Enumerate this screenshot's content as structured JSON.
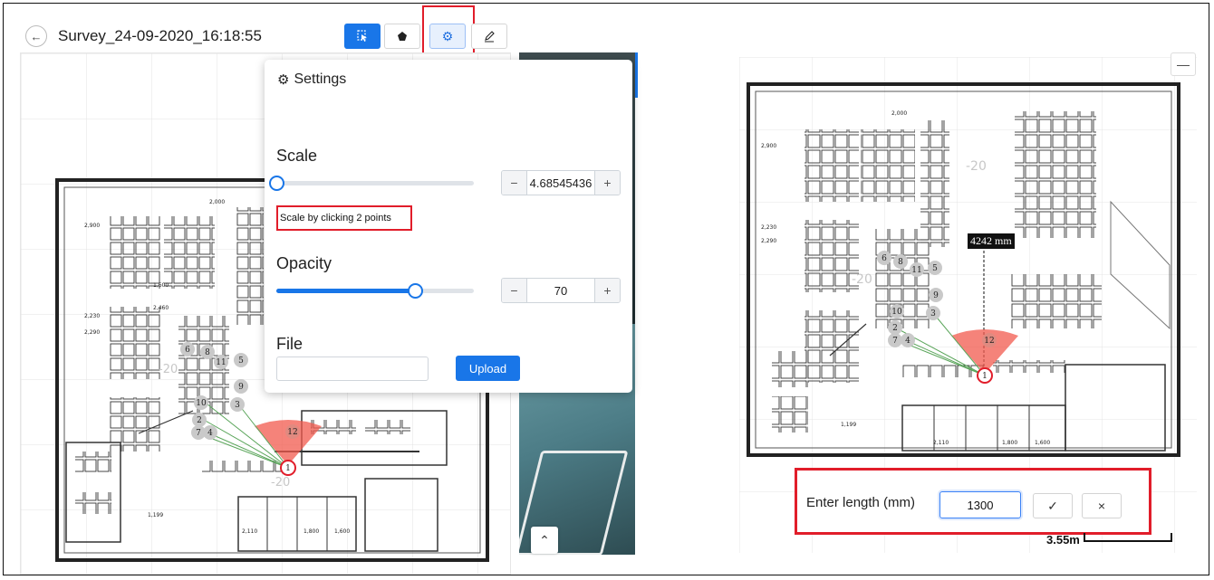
{
  "header": {
    "back_icon": "arrow-left-icon",
    "title": "Survey_24-09-2020_16:18:55",
    "tools": [
      {
        "name": "select-tool",
        "icon": "cursor-icon",
        "state": "active"
      },
      {
        "name": "shape-tool",
        "icon": "polygon-icon",
        "state": "normal"
      },
      {
        "name": "settings-tool",
        "icon": "gear-icon",
        "state": "selected",
        "highlighted": true
      },
      {
        "name": "draw-tool",
        "icon": "pen-icon",
        "state": "normal"
      }
    ]
  },
  "settings": {
    "title": "Settings",
    "scale": {
      "label": "Scale",
      "value": "4.68545436",
      "slider_fraction": 0.0,
      "hint": "Scale by clicking 2 points",
      "minus": "−",
      "plus": "+"
    },
    "opacity": {
      "label": "Opacity",
      "value": "70",
      "slider_fraction": 0.7,
      "minus": "−",
      "plus": "+"
    },
    "file": {
      "label": "File",
      "upload_label": "Upload"
    }
  },
  "map_left": {
    "markers": [
      "6",
      "8",
      "11",
      "5",
      "9",
      "10",
      "3",
      "2",
      "7",
      "4",
      "12",
      "1"
    ],
    "grid_labels": [
      "-20",
      "-20"
    ],
    "dims": [
      "2,000",
      "2,900",
      "2,230",
      "2,290",
      "2,460",
      "1,600",
      "1,199",
      "2,110",
      "1,800",
      "1,600"
    ]
  },
  "map_right": {
    "measurement": "4242 mm",
    "markers": [
      "6",
      "8",
      "11",
      "5",
      "9",
      "10",
      "3",
      "2",
      "7",
      "4",
      "12",
      "1"
    ],
    "grid_labels": [
      "-20",
      "-20"
    ],
    "minimize_label": "—",
    "scale_bar": "3.55m"
  },
  "length_dialog": {
    "label": "Enter length (mm)",
    "value": "1300",
    "confirm_icon": "check-icon",
    "confirm_glyph": "✓",
    "cancel_icon": "close-icon",
    "cancel_glyph": "×"
  },
  "photo": {
    "up_glyph": "⌃"
  },
  "colors": {
    "accent": "#1976e8",
    "highlight": "#e11d2a",
    "marker": "#c9c9c9",
    "cone": "#f25a4e"
  }
}
